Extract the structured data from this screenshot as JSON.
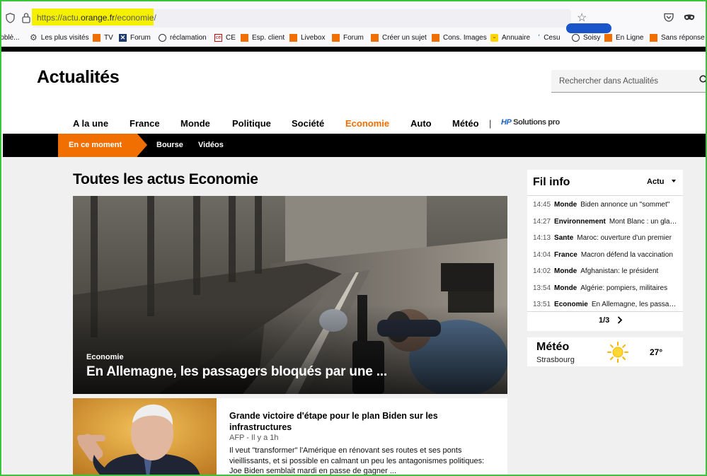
{
  "browser": {
    "url_prefix": "https://actu.",
    "url_domain": "orange.fr",
    "url_path": "/economie/",
    "bookmarks": [
      {
        "label": "roblè...",
        "icon": "none"
      },
      {
        "label": "Les plus visités",
        "icon": "gear-icon"
      },
      {
        "label": "TV",
        "icon": "orange-square-icon"
      },
      {
        "label": "Forum",
        "icon": "x-logo-icon"
      },
      {
        "label": "réclamation",
        "icon": "globe-icon"
      },
      {
        "label": "CE",
        "icon": "ce-logo-icon"
      },
      {
        "label": "Esp. client",
        "icon": "orange-square-icon"
      },
      {
        "label": "Livebox",
        "icon": "orange-square-icon"
      },
      {
        "label": "Forum",
        "icon": "orange-square-icon"
      },
      {
        "label": "Créer un sujet",
        "icon": "orange-square-icon"
      },
      {
        "label": "Cons. Images",
        "icon": "orange-square-icon"
      },
      {
        "label": "Annuaire",
        "icon": "smiley-icon"
      },
      {
        "label": "Cesu",
        "icon": "cesu-icon"
      },
      {
        "label": "Soisy",
        "icon": "globe-icon"
      },
      {
        "label": "En Ligne",
        "icon": "orange-square-icon"
      },
      {
        "label": "Sans réponse",
        "icon": "orange-square-icon"
      }
    ]
  },
  "site": {
    "title": "Actualités",
    "search_placeholder": "Rechercher dans Actualités"
  },
  "nav": {
    "items": [
      "A la une",
      "France",
      "Monde",
      "Politique",
      "Société",
      "Economie",
      "Auto",
      "Météo"
    ],
    "active": "Economie",
    "partner_brand": "HP",
    "partner_label": "Solutions pro"
  },
  "subnav": {
    "active": "En ce moment",
    "links": [
      "Bourse",
      "Vidéos"
    ]
  },
  "main": {
    "section_title": "Toutes les actus Economie",
    "hero": {
      "category": "Economie",
      "title": "En Allemagne, les passagers bloqués par une ..."
    },
    "card": {
      "title": "Grande victoire d'étape pour le plan Biden sur les infrastructures",
      "meta": "AFP - Il y a 1h",
      "excerpt": "Il veut \"transformer\" l'Amérique en rénovant ses routes et ses ponts vieillissants, et si possible en calmant un peu les antagonismes politiques: Joe Biden semblait mardi en passe de gagner ..."
    }
  },
  "filinfo": {
    "title": "Fil info",
    "filter": "Actu",
    "items": [
      {
        "time": "14:45",
        "category": "Monde",
        "text": "Biden annonce un \"sommet\""
      },
      {
        "time": "14:27",
        "category": "Environnement",
        "text": "Mont Blanc : un glacier"
      },
      {
        "time": "14:13",
        "category": "Sante",
        "text": "Maroc: ouverture d'un premier"
      },
      {
        "time": "14:04",
        "category": "France",
        "text": "Macron défend la vaccination"
      },
      {
        "time": "14:02",
        "category": "Monde",
        "text": "Afghanistan: le président"
      },
      {
        "time": "13:54",
        "category": "Monde",
        "text": "Algérie: pompiers, militaires"
      },
      {
        "time": "13:51",
        "category": "Economie",
        "text": "En Allemagne, les passagers"
      }
    ],
    "pager": "1/3"
  },
  "meteo": {
    "title": "Météo",
    "city": "Strasbourg",
    "temperature": "27°",
    "icon": "sun-icon"
  },
  "colors": {
    "accent": "#f16e00",
    "frame": "#3cc43c",
    "url_highlight": "#f4f000"
  }
}
